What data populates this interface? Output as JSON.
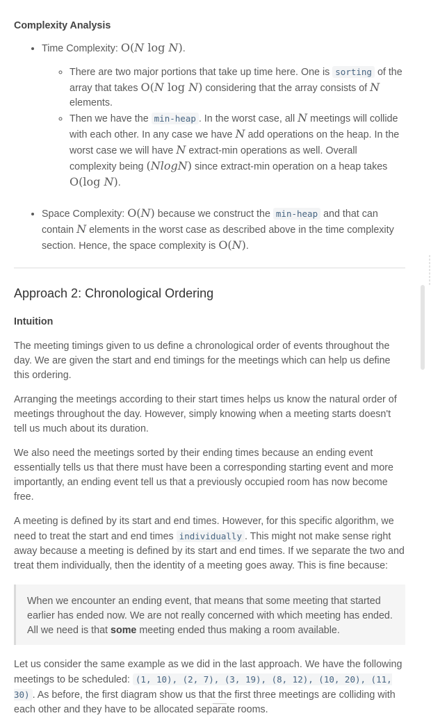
{
  "analysis": {
    "heading": "Complexity Analysis",
    "time_label": "Time Complexity:",
    "sub1": {
      "a": "There are two major portions that take up time here. One is",
      "code": "sorting",
      "b": "of the array that takes",
      "c": "considering that the array consists of",
      "d": "elements."
    },
    "sub2": {
      "a": "Then we have the",
      "code": "min-heap",
      "b": ". In the worst case, all",
      "c": "meetings will collide with each other. In any case we have",
      "d": "add operations on the heap. In the worst case we will have",
      "e": "extract-min operations as well. Overall complexity being",
      "f": "since extract-min operation on a heap takes"
    },
    "space_label": "Space Complexity:",
    "space": {
      "a": "because we construct the",
      "code": "min-heap",
      "b": "and that can contain",
      "c": "elements in the worst case as described above in the time complexity section. Hence, the space complexity is"
    }
  },
  "approach": {
    "title": "Approach 2: Chronological Ordering",
    "intuition_label": "Intuition",
    "p1": "The meeting timings given to us define a chronological order of events throughout the day. We are given the start and end timings for the meetings which can help us define this ordering.",
    "p2": "Arranging the meetings according to their start times helps us know the natural order of meetings throughout the day. However, simply knowing when a meeting starts doesn't tell us much about its duration.",
    "p3": "We also need the meetings sorted by their ending times because an ending event essentially tells us that there must have been a corresponding starting event and more importantly, an ending event tell us that a previously occupied room has now become free.",
    "p4a": "A meeting is defined by its start and end times. However, for this specific algorithm, we need to treat the start and end times",
    "p4code": "individually",
    "p4b": ". This might not make sense right away because a meeting is defined by its start and end times. If we separate the two and treat them individually, then the identity of a meeting goes away. This is fine because:",
    "quote_a": "When we encounter an ending event, that means that some meeting that started earlier has ended now. We are not really concerned with which meeting has ended. All we need is that",
    "quote_bold": "some",
    "quote_b": "meeting ended thus making a room available.",
    "p5a": "Let us consider the same example as we did in the last approach. We have the following meetings to be scheduled:",
    "p5code": "(1, 10), (2, 7), (3, 19), (8, 12), (10, 20), (11, 30)",
    "p5b": ". As before, the first diagram show us that the first three meetings are colliding with each other and they have to be allocated separate rooms."
  }
}
